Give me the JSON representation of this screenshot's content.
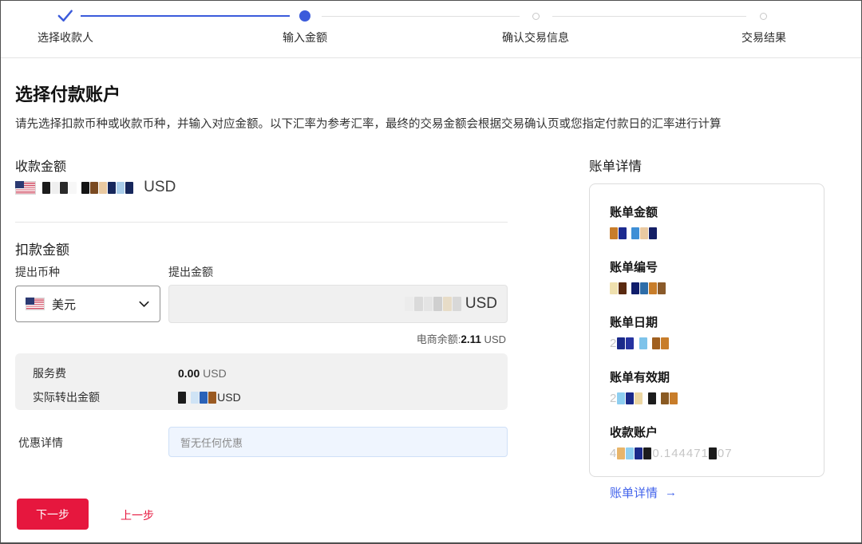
{
  "stepper": {
    "steps": [
      {
        "label": "选择收款人",
        "state": "done"
      },
      {
        "label": "输入金额",
        "state": "active"
      },
      {
        "label": "确认交易信息",
        "state": "pending"
      },
      {
        "label": "交易结果",
        "state": "pending"
      }
    ]
  },
  "page": {
    "title": "选择付款账户",
    "subtitle": "请先选择扣款币种或收款币种，并输入对应金额。以下汇率为参考汇率，最终的交易金额会根据交易确认页或您指定付款日的汇率进行计算"
  },
  "receive": {
    "label": "收款金额",
    "flag_icon": "us-flag",
    "currency": "USD"
  },
  "deduct": {
    "label": "扣款金额",
    "currency_field_label": "提出币种",
    "currency_value": "美元",
    "currency_flag_icon": "us-flag",
    "amount_field_label": "提出金额",
    "amount_currency": "USD",
    "balance_prefix": "电商余额:",
    "balance_amount": "2.11",
    "balance_currency": " USD"
  },
  "fees": {
    "service_fee_label": "服务费",
    "service_fee_amount": "0.00",
    "service_fee_currency": " USD",
    "actual_out_label": "实际转出金额",
    "actual_out_currency": "USD"
  },
  "promo": {
    "label": "优惠详情",
    "empty_text": "暂无任何优惠"
  },
  "bill": {
    "title": "账单详情",
    "items": [
      {
        "label": "账单金额"
      },
      {
        "label": "账单编号"
      },
      {
        "label": "账单日期"
      },
      {
        "label": "账单有效期"
      },
      {
        "label": "收款账户"
      }
    ],
    "link_label": "账单详情",
    "link_arrow": "→"
  },
  "actions": {
    "next_label": "下一步",
    "prev_label": "上一步"
  },
  "colors": {
    "accent_blue": "#3b5bdb",
    "link_blue": "#4263eb",
    "primary_red": "#e6173e"
  },
  "mosaics": {
    "receive_amount": [
      {
        "b": "#1c1c1c"
      },
      {
        "b": "#efefef"
      },
      {
        "b": "#2a2a2a"
      },
      {
        "b": "#f7f7f7"
      },
      {
        "t": " "
      },
      {
        "b": "#141414"
      },
      {
        "b": "#7a4a21"
      },
      {
        "b": "#e9c9a1"
      },
      {
        "b": "#16275c"
      },
      {
        "b": "#a9cdea"
      },
      {
        "b": "#16275c"
      }
    ],
    "deduct_amount": [
      {
        "b": "#ececec"
      },
      {
        "b": "#dadada"
      },
      {
        "b": "#e4e4e4"
      },
      {
        "b": "#cfcfcf"
      },
      {
        "b": "#e7dcc7"
      },
      {
        "b": "#d8d8d8"
      }
    ],
    "actual_out": [
      {
        "b": "#1b1b1b"
      },
      {
        "t": " "
      },
      {
        "b": "#cfe3f5"
      },
      {
        "b": "#2a62b8"
      },
      {
        "b": "#9a5a22"
      }
    ],
    "bill_amount": [
      {
        "b": "#c87d2a"
      },
      {
        "b": "#1c2a8f"
      },
      {
        "t": " "
      },
      {
        "b": "#3f8fd6"
      },
      {
        "b": "#e9c9a1"
      },
      {
        "b": "#141f66"
      }
    ],
    "bill_number": [
      {
        "b": "#efe0ae"
      },
      {
        "b": "#5a2a10"
      },
      {
        "t": " "
      },
      {
        "b": "#101d6b"
      },
      {
        "b": "#2e6da8"
      },
      {
        "b": "#c87d2a"
      },
      {
        "b": "#8a5a2a"
      }
    ],
    "bill_date": [
      {
        "t": "2"
      },
      {
        "b": "#1b2a8a"
      },
      {
        "b": "#2633a0"
      },
      {
        "t": " "
      },
      {
        "b": "#7ec3ea"
      },
      {
        "t": " "
      },
      {
        "b": "#a06020"
      },
      {
        "b": "#c87d2a"
      }
    ],
    "bill_validity": [
      {
        "t": "2"
      },
      {
        "b": "#8ecef0"
      },
      {
        "b": "#1b2a8a"
      },
      {
        "b": "#ecd6a2"
      },
      {
        "t": " "
      },
      {
        "b": "#1c1c1c"
      },
      {
        "t": " "
      },
      {
        "b": "#8a5a22"
      },
      {
        "b": "#c87d2a"
      }
    ],
    "bill_account": [
      {
        "t": "4"
      },
      {
        "b": "#e8b56a"
      },
      {
        "b": "#8ecef0"
      },
      {
        "b": "#1b2a8a"
      },
      {
        "b": "#1c1c1c"
      },
      {
        "t": "0.144471"
      },
      {
        "b": "#1c1c1c"
      },
      {
        "t": "07"
      }
    ]
  }
}
